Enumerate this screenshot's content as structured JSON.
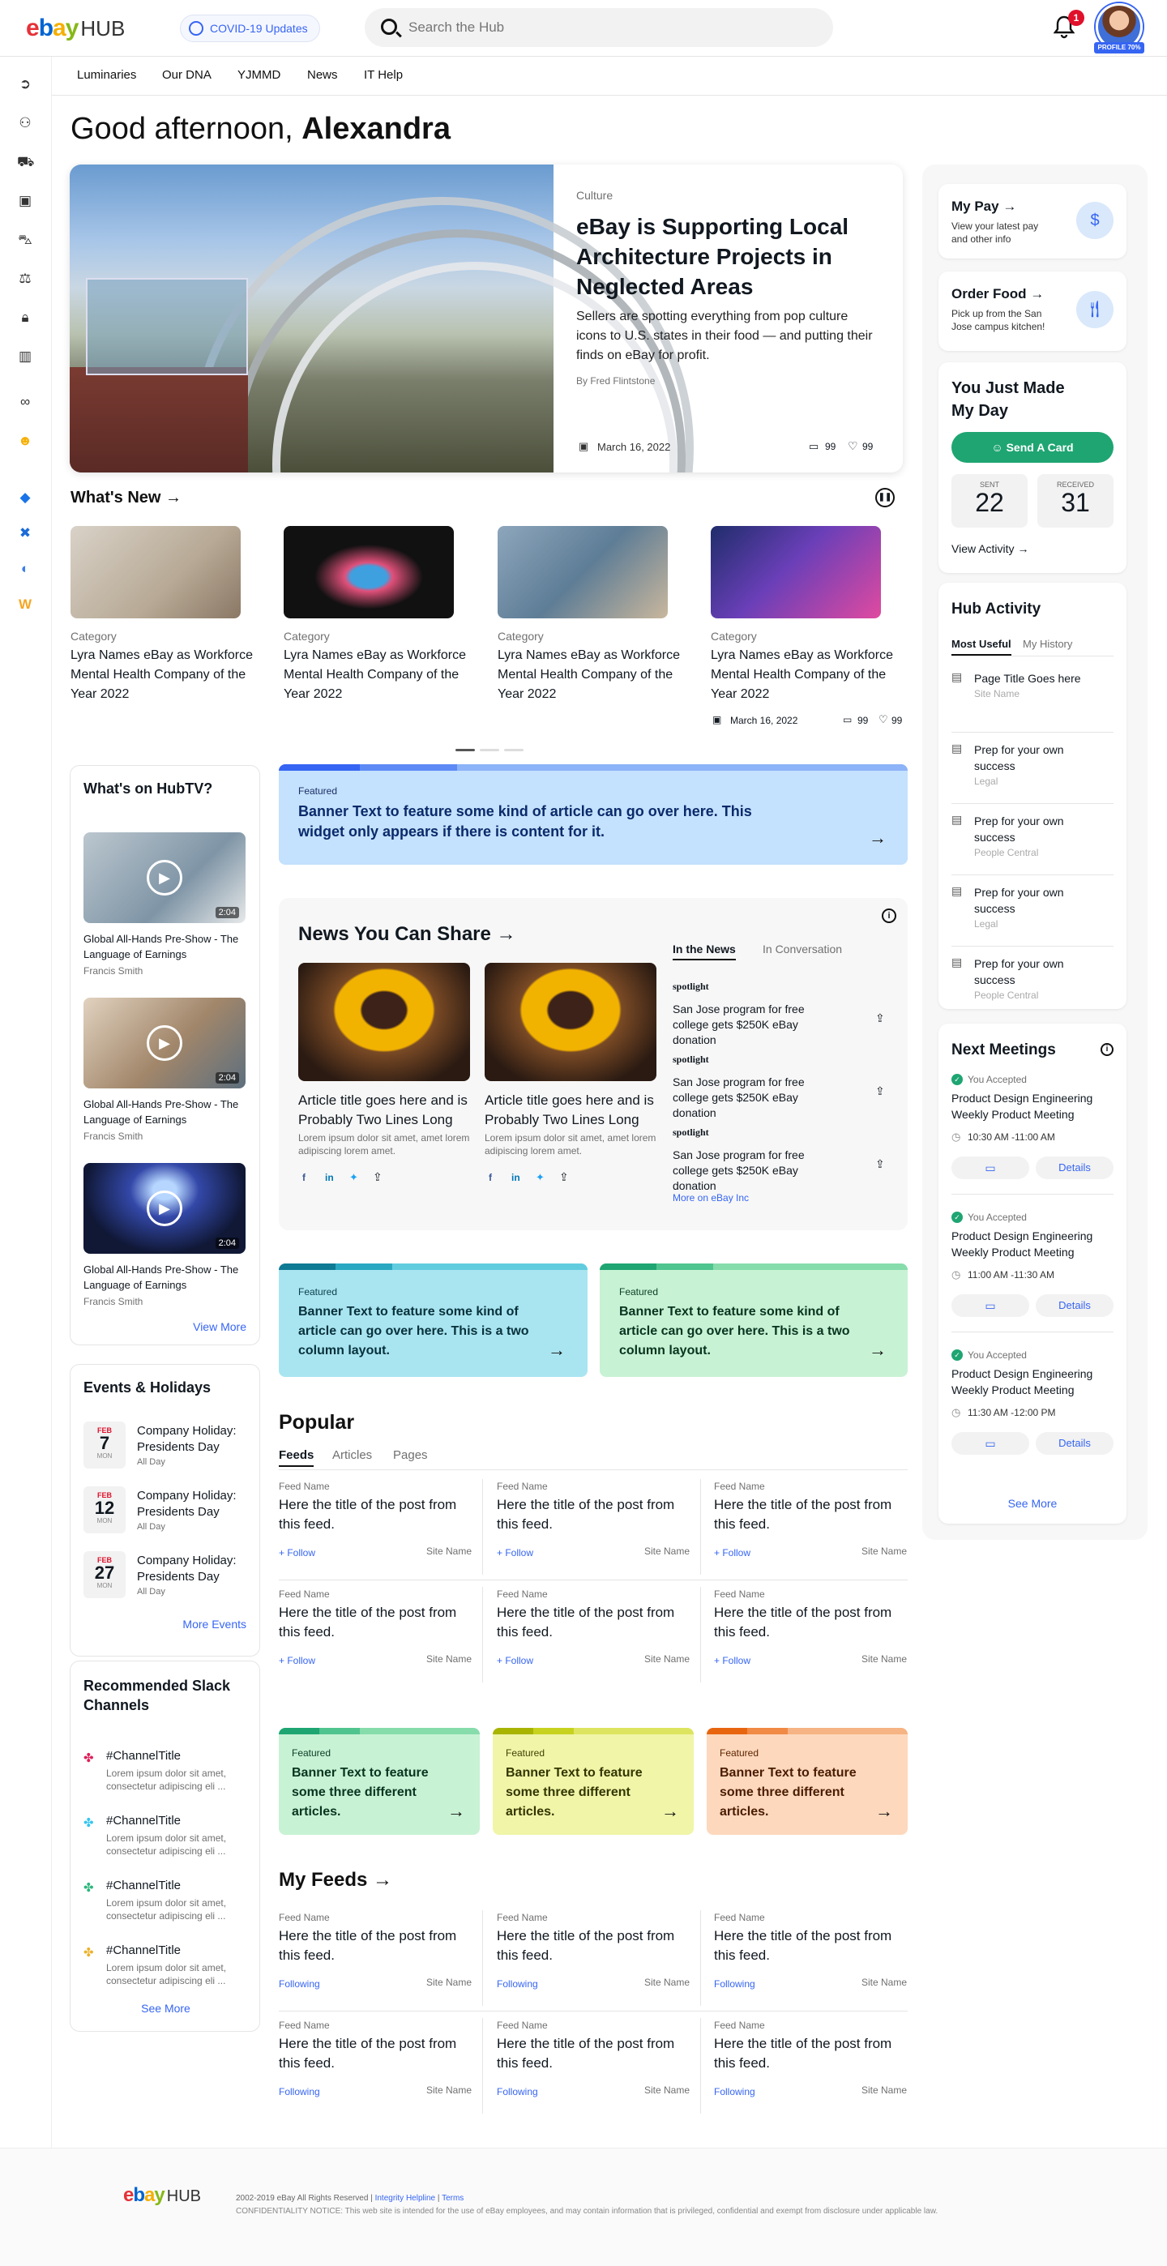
{
  "header": {
    "logo_brand": "ebay",
    "logo_suffix": "HUB",
    "covid_label": "COVID-19 Updates",
    "search_placeholder": "Search the Hub",
    "notification_count": "1",
    "profile_label": "PROFILE 70%"
  },
  "subnav": [
    "Luminaries",
    "Our DNA",
    "YJMMD",
    "News",
    "IT Help"
  ],
  "greeting": {
    "prefix": "Good afternoon,",
    "name": "Alexandra"
  },
  "hero": {
    "category": "Culture",
    "title": "eBay is Supporting Local Architecture Projects in Neglected Areas",
    "summary": "Sellers are spotting everything from pop culture icons to U.S. states in their food — and putting their finds on eBay for profit.",
    "author": "By Fred Flintstone",
    "date": "March 16, 2022",
    "comments": "99",
    "likes": "99"
  },
  "whats_new": {
    "title": "What's New",
    "items": [
      {
        "category": "Category",
        "title": "Lyra Names eBay as Workforce Mental Health Company of the Year 2022"
      },
      {
        "category": "Category",
        "title": "Lyra Names eBay as Workforce Mental Health Company of the Year 2022"
      },
      {
        "category": "Category",
        "title": "Lyra Names eBay as Workforce Mental Health Company of the Year 2022"
      },
      {
        "category": "Category",
        "title": "Lyra Names eBay as Workforce Mental Health Company of the Year 2022",
        "date": "March 16, 2022",
        "comments": "99",
        "likes": "99"
      }
    ]
  },
  "hubtv": {
    "title": "What's on HubTV?",
    "videos": [
      {
        "duration": "2:04",
        "title": "Global All-Hands Pre-Show - The Language of Earnings",
        "author": "Francis Smith"
      },
      {
        "duration": "2:04",
        "title": "Global All-Hands Pre-Show - The Language of Earnings",
        "author": "Francis Smith"
      },
      {
        "duration": "2:04",
        "title": "Global All-Hands Pre-Show - The Language of Earnings",
        "author": "Francis Smith"
      }
    ],
    "view_more": "View More"
  },
  "events": {
    "title": "Events & Holidays",
    "items": [
      {
        "month": "FEB",
        "day": "7",
        "dow": "MON",
        "title": "Company Holiday: Presidents Day",
        "time": "All Day"
      },
      {
        "month": "FEB",
        "day": "12",
        "dow": "MON",
        "title": "Company Holiday: Presidents Day",
        "time": "All Day"
      },
      {
        "month": "FEB",
        "day": "27",
        "dow": "MON",
        "title": "Company Holiday: Presidents Day",
        "time": "All Day"
      }
    ],
    "more": "More Events"
  },
  "slack": {
    "title": "Recommended Slack Channels",
    "items": [
      {
        "name": "#ChannelTitle",
        "desc": "Lorem ipsum dolor sit amet, consectetur adipiscing eli ..."
      },
      {
        "name": "#ChannelTitle",
        "desc": "Lorem ipsum dolor sit amet, consectetur adipiscing eli ..."
      },
      {
        "name": "#ChannelTitle",
        "desc": "Lorem ipsum dolor sit amet, consectetur adipiscing eli ..."
      },
      {
        "name": "#ChannelTitle",
        "desc": "Lorem ipsum dolor sit amet, consectetur adipiscing eli ..."
      }
    ],
    "more": "See More"
  },
  "featured_main": {
    "label": "Featured",
    "text": "Banner Text to feature some kind of article can go over here. This widget only appears if there is content for it."
  },
  "news_share": {
    "title": "News You Can Share",
    "cards": [
      {
        "title": "Article title goes here and is Probably Two Lines Long",
        "desc": "Lorem ipsum dolor sit amet, amet lorem adipiscing lorem amet."
      },
      {
        "title": "Article title goes here and is Probably Two Lines Long",
        "desc": "Lorem ipsum dolor sit amet, amet lorem adipiscing lorem amet."
      }
    ],
    "tabs": [
      "In the News",
      "In Conversation"
    ],
    "news": [
      {
        "source": "spotlight",
        "title": "San Jose program for free college gets $250K eBay donation"
      },
      {
        "source": "spotlight",
        "title": "San Jose program for free college gets $250K eBay donation"
      },
      {
        "source": "spotlight",
        "title": "San Jose program for free college gets $250K eBay donation"
      }
    ],
    "more": "More on eBay Inc"
  },
  "two_col": [
    {
      "label": "Featured",
      "text": "Banner Text to feature some kind of article can go over here. This is a two column layout."
    },
    {
      "label": "Featured",
      "text": "Banner Text to feature some kind of article can go over here. This is a two column layout."
    }
  ],
  "popular": {
    "title": "Popular",
    "tabs": [
      "Feeds",
      "Articles",
      "Pages"
    ],
    "items": [
      {
        "feed": "Feed Name",
        "title": "Here the title of the post from this feed.",
        "action": "+ Follow",
        "site": "Site Name"
      },
      {
        "feed": "Feed Name",
        "title": "Here the title of the post from this feed.",
        "action": "+ Follow",
        "site": "Site Name"
      },
      {
        "feed": "Feed Name",
        "title": "Here the title of the post from this feed.",
        "action": "+ Follow",
        "site": "Site Name"
      },
      {
        "feed": "Feed Name",
        "title": "Here the title of the post from this feed.",
        "action": "+ Follow",
        "site": "Site Name"
      },
      {
        "feed": "Feed Name",
        "title": "Here the title of the post from this feed.",
        "action": "+ Follow",
        "site": "Site Name"
      },
      {
        "feed": "Feed Name",
        "title": "Here the title of the post from this feed.",
        "action": "+ Follow",
        "site": "Site Name"
      }
    ]
  },
  "three_col": [
    {
      "label": "Featured",
      "text": "Banner Text to feature some three different articles."
    },
    {
      "label": "Featured",
      "text": "Banner Text to feature some three different articles."
    },
    {
      "label": "Featured",
      "text": "Banner Text to feature some three different articles."
    }
  ],
  "my_feeds": {
    "title": "My Feeds",
    "items": [
      {
        "feed": "Feed Name",
        "title": "Here the title of the post from this feed.",
        "action": "Following",
        "site": "Site Name"
      },
      {
        "feed": "Feed Name",
        "title": "Here the title of the post from this feed.",
        "action": "Following",
        "site": "Site Name"
      },
      {
        "feed": "Feed Name",
        "title": "Here the title of the post from this feed.",
        "action": "Following",
        "site": "Site Name"
      },
      {
        "feed": "Feed Name",
        "title": "Here the title of the post from this feed.",
        "action": "Following",
        "site": "Site Name"
      },
      {
        "feed": "Feed Name",
        "title": "Here the title of the post from this feed.",
        "action": "Following",
        "site": "Site Name"
      },
      {
        "feed": "Feed Name",
        "title": "Here the title of the post from this feed.",
        "action": "Following",
        "site": "Site Name"
      }
    ]
  },
  "right": {
    "pay": {
      "title": "My Pay",
      "desc": "View your latest pay and other info"
    },
    "food": {
      "title": "Order Food",
      "desc": "Pick up from the San Jose campus kitchen!"
    },
    "myday": {
      "title": "You Just Made My Day",
      "button": "Send A Card",
      "sent_label": "SENT",
      "sent": "22",
      "received_label": "RECEIVED",
      "received": "31",
      "view": "View Activity"
    },
    "activity": {
      "title": "Hub Activity",
      "tabs": [
        "Most Useful",
        "My History"
      ],
      "items": [
        {
          "title": "Page Title Goes here",
          "sub": "Site Name"
        },
        {
          "title": "Prep for your own success",
          "sub": "Legal"
        },
        {
          "title": "Prep for your own success",
          "sub": "People Central"
        },
        {
          "title": "Prep for your own success",
          "sub": "Legal"
        },
        {
          "title": "Prep for your own success",
          "sub": "People Central"
        }
      ]
    },
    "meetings": {
      "title": "Next Meetings",
      "items": [
        {
          "status": "You Accepted",
          "title": "Product Design Engineering Weekly Product Meeting",
          "time": "10:30 AM -11:00 AM",
          "details": "Details"
        },
        {
          "status": "You Accepted",
          "title": "Product Design Engineering Weekly Product Meeting",
          "time": "11:00 AM -11:30 AM",
          "details": "Details"
        },
        {
          "status": "You Accepted",
          "title": "Product Design Engineering Weekly Product Meeting",
          "time": "11:30 AM -12:00 PM",
          "details": "Details"
        }
      ],
      "more": "See More"
    }
  },
  "footer": {
    "copyright": "2002-2019 eBay All Rights Reserved",
    "helpline": "Integrity Helpline",
    "terms": "Terms",
    "notice": "CONFIDENTIALITY NOTICE: This web site is intended for the use of eBay employees, and may contain information that is privileged, confidential and exempt from disclosure under applicable law."
  },
  "colors": {
    "accent": "#3665f3",
    "green": "#1ea572",
    "featured_blue": "#c4e1fd",
    "featured_teal": "#a9e5f0",
    "featured_green": "#c8f2d4",
    "featured_yellow": "#f0f5a8",
    "featured_orange": "#fdd8bd"
  }
}
